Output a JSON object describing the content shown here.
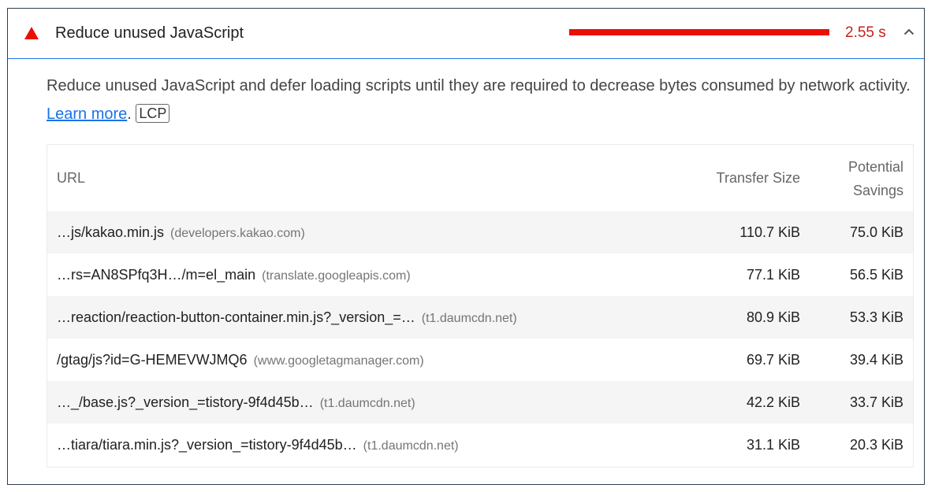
{
  "audit": {
    "title": "Reduce unused JavaScript",
    "metric_value": "2.55 s",
    "description_text": "Reduce unused JavaScript and defer loading scripts until they are required to decrease bytes consumed by network activity.",
    "learn_more": "Learn more",
    "period": ".",
    "badge": "LCP",
    "colors": {
      "fail": "#eb0f00",
      "link": "#1a73e8",
      "value": "#c5221f"
    }
  },
  "table": {
    "headers": {
      "url": "URL",
      "transfer_size": "Transfer Size",
      "potential_savings_line1": "Potential",
      "potential_savings_line2": "Savings"
    },
    "rows": [
      {
        "url": "…js/kakao.min.js",
        "host": "(developers.kakao.com)",
        "size": "110.7 KiB",
        "savings": "75.0 KiB"
      },
      {
        "url": "…rs=AN8SPfq3H…/m=el_main",
        "host": "(translate.googleapis.com)",
        "size": "77.1 KiB",
        "savings": "56.5 KiB"
      },
      {
        "url": "…reaction/reaction-button-container.min.js?_version_=…",
        "host": "(t1.daumcdn.net)",
        "size": "80.9 KiB",
        "savings": "53.3 KiB"
      },
      {
        "url": "/gtag/js?id=G-HEMEVWJMQ6",
        "host": "(www.googletagmanager.com)",
        "size": "69.7 KiB",
        "savings": "39.4 KiB"
      },
      {
        "url": "…_/base.js?_version_=tistory-9f4d45b…",
        "host": "(t1.daumcdn.net)",
        "size": "42.2 KiB",
        "savings": "33.7 KiB"
      },
      {
        "url": "…tiara/tiara.min.js?_version_=tistory-9f4d45b…",
        "host": "(t1.daumcdn.net)",
        "size": "31.1 KiB",
        "savings": "20.3 KiB"
      }
    ]
  }
}
